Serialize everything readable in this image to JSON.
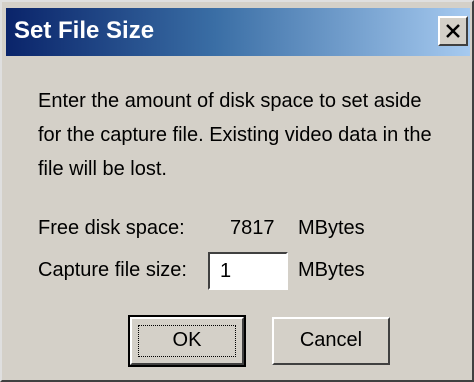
{
  "window": {
    "title": "Set File Size",
    "close_glyph": "x",
    "close_icon": "close-icon"
  },
  "content": {
    "instructions": "Enter the amount of disk space to set aside for the capture file.  Existing video data in the file will be lost.",
    "free_space_label": "Free disk space:",
    "free_space_value": "7817",
    "free_space_unit": "MBytes",
    "capture_size_label": "Capture file size:",
    "capture_size_value": "1",
    "capture_size_unit": "MBytes"
  },
  "buttons": {
    "ok_label": "OK",
    "cancel_label": "Cancel"
  },
  "colors": {
    "face": "#d4d0c8",
    "title_start": "#0a246a",
    "title_end": "#a6caf0"
  }
}
